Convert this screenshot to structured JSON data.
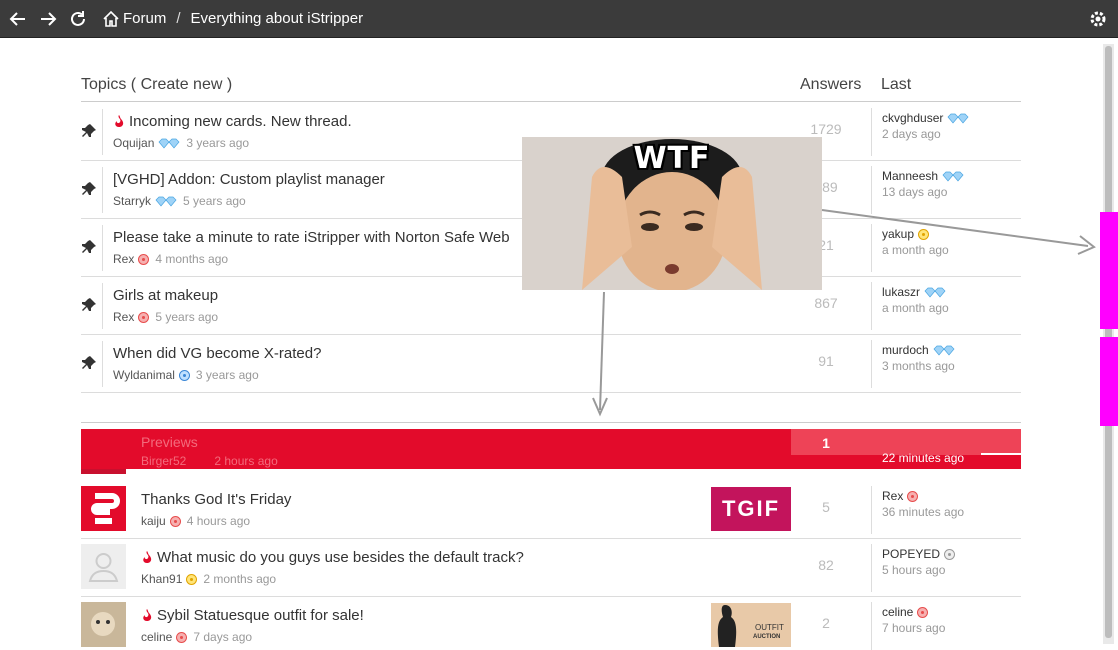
{
  "nav": {
    "back_icon": "arrow-left-icon",
    "forward_icon": "arrow-right-icon",
    "reload_icon": "reload-icon",
    "home_icon": "home-icon",
    "breadcrumb_forum": "Forum",
    "breadcrumb_sep": "/",
    "breadcrumb_current": "Everything about iStripper",
    "settings_icon": "gear-icon"
  },
  "header": {
    "topics": "Topics ( Create new )",
    "answers": "Answers",
    "last": "Last"
  },
  "pinned": [
    {
      "title": "Incoming new cards. New thread.",
      "author": "Oquijan",
      "ago": "3 years ago",
      "answers": "1729",
      "last_user": "ckvghduser",
      "last_ago": "2 days ago"
    },
    {
      "title": "[VGHD] Addon: Custom playlist manager",
      "author": "Starryk",
      "ago": "5 years ago",
      "answers": "489",
      "last_user": "Manneesh",
      "last_ago": "13 days ago"
    },
    {
      "title": "Please take a minute to rate iStripper with Norton Safe Web",
      "author": "Rex",
      "ago": "4 months ago",
      "answers": "21",
      "last_user": "yakup",
      "last_ago": "a month ago"
    },
    {
      "title": "Girls at makeup",
      "author": "Rex",
      "ago": "5 years ago",
      "answers": "867",
      "last_user": "lukaszr",
      "last_ago": "a month ago"
    },
    {
      "title": "When did VG become X-rated?",
      "author": "Wyldanimal",
      "ago": "3 years ago",
      "answers": "91",
      "last_user": "murdoch",
      "last_ago": "3 months ago"
    }
  ],
  "previews": {
    "title": "Previews",
    "author": "Birger52",
    "ago": "2 hours ago",
    "answers": "1",
    "last_ago": "22 minutes ago"
  },
  "threads": [
    {
      "title": "Thanks God It's Friday",
      "author": "kaiju",
      "ago": "4 hours ago",
      "answers": "5",
      "last_user": "Rex",
      "last_ago": "36 minutes ago",
      "promo": "TGIF"
    },
    {
      "title": "What music do you guys use besides the default track?",
      "author": "Khan91",
      "ago": "2 months ago",
      "answers": "82",
      "last_user": "POPEYED",
      "last_ago": "5 hours ago"
    },
    {
      "title": "Sybil Statuesque outfit for sale!",
      "author": "celine",
      "ago": "7 days ago",
      "answers": "2",
      "last_user": "celine",
      "last_ago": "7 hours ago",
      "promo_line1": "OUTFIT",
      "promo_line2": "AUCTION"
    }
  ],
  "overlay": {
    "caption": "WTF"
  },
  "colors": {
    "accent": "#e30b2b",
    "sidebar_tab": "#ff00ff",
    "topbar": "#3b3b3b"
  }
}
